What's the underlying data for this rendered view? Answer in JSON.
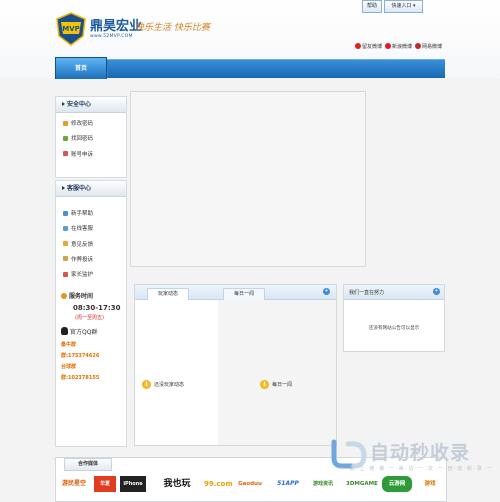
{
  "header": {
    "brand": "鼎昊宏业",
    "logo_text": "MVP",
    "url": "www.52MVP.COM",
    "slogan": "快乐生活 快乐比赛",
    "top_buttons": [
      "帮助",
      "快速入口"
    ],
    "links": [
      "留友微博",
      "新浪微博",
      "网易微博"
    ]
  },
  "nav": {
    "home": "首页"
  },
  "sidebar": {
    "security": {
      "title": "安全中心",
      "items": [
        "修改密码",
        "找回密码",
        "账号申诉"
      ]
    },
    "service": {
      "title": "客服中心",
      "items": [
        "新手帮助",
        "在线客服",
        "意见反馈",
        "作弊投诉",
        "家长监护"
      ]
    },
    "hours": {
      "title": "服务时间",
      "time": "08:30-17:30",
      "days": "(周一至周五)"
    },
    "qq": {
      "title": "官方QQ群",
      "groups": [
        {
          "name": "桑牛群",
          "number": "群:175374626"
        },
        {
          "name": "台球群",
          "number": "群:102378155"
        }
      ]
    }
  },
  "dynamics": {
    "tabs": [
      "玩家动态",
      "每日一闻"
    ],
    "left_empty": "还没玩家动态",
    "right_empty": "每日一闻"
  },
  "notice": {
    "title": "我们一直在努力",
    "empty": "还没有网站公告可以显示"
  },
  "media": {
    "title": "合作媒体",
    "partners": [
      "游民星空",
      "华夏",
      "iPhone",
      "我也玩",
      "99.com",
      "Gaoduu",
      "51APP",
      "游戏资讯",
      "3DMGAME",
      "云游网",
      "游戏"
    ]
  },
  "watermark": {
    "main": "自动秒收录",
    "sub": "一 · 数 · 上 · 链 · 接 · 一 · 来 · 访 · 一 · 次 · 一 · 自 · 动 · 收 · 录 · 一"
  }
}
